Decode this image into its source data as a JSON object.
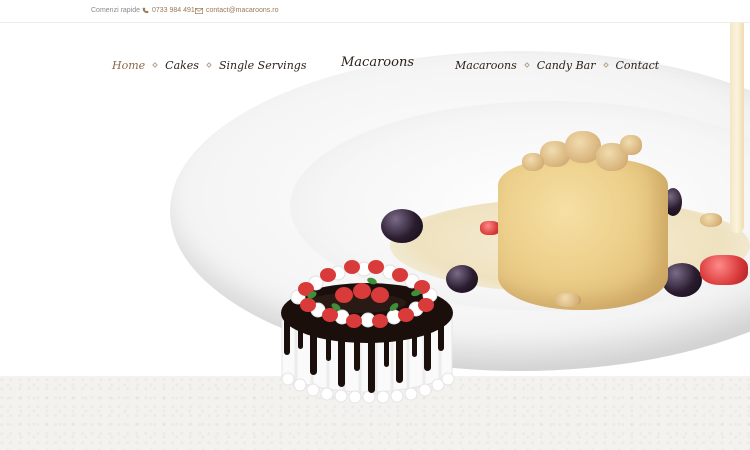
{
  "topbar": {
    "quick_orders_label": "Comenzi rapide",
    "phone": "0733 984 491",
    "email": "contact@macaroons.ro"
  },
  "nav": {
    "left_items": [
      {
        "label": "Home",
        "active": true
      },
      {
        "label": "Cakes",
        "active": false
      },
      {
        "label": "Single Servings",
        "active": false
      }
    ],
    "brand": "Macaroons",
    "right_items": [
      {
        "label": "Macaroons",
        "active": false
      },
      {
        "label": "Candy Bar",
        "active": false
      },
      {
        "label": "Contact",
        "active": false
      }
    ]
  },
  "colors": {
    "accent": "#8a6a4a",
    "text_dark": "#2b1f1a",
    "chocolate": "#1b0f0c",
    "strawberry": "#d93a3a"
  }
}
